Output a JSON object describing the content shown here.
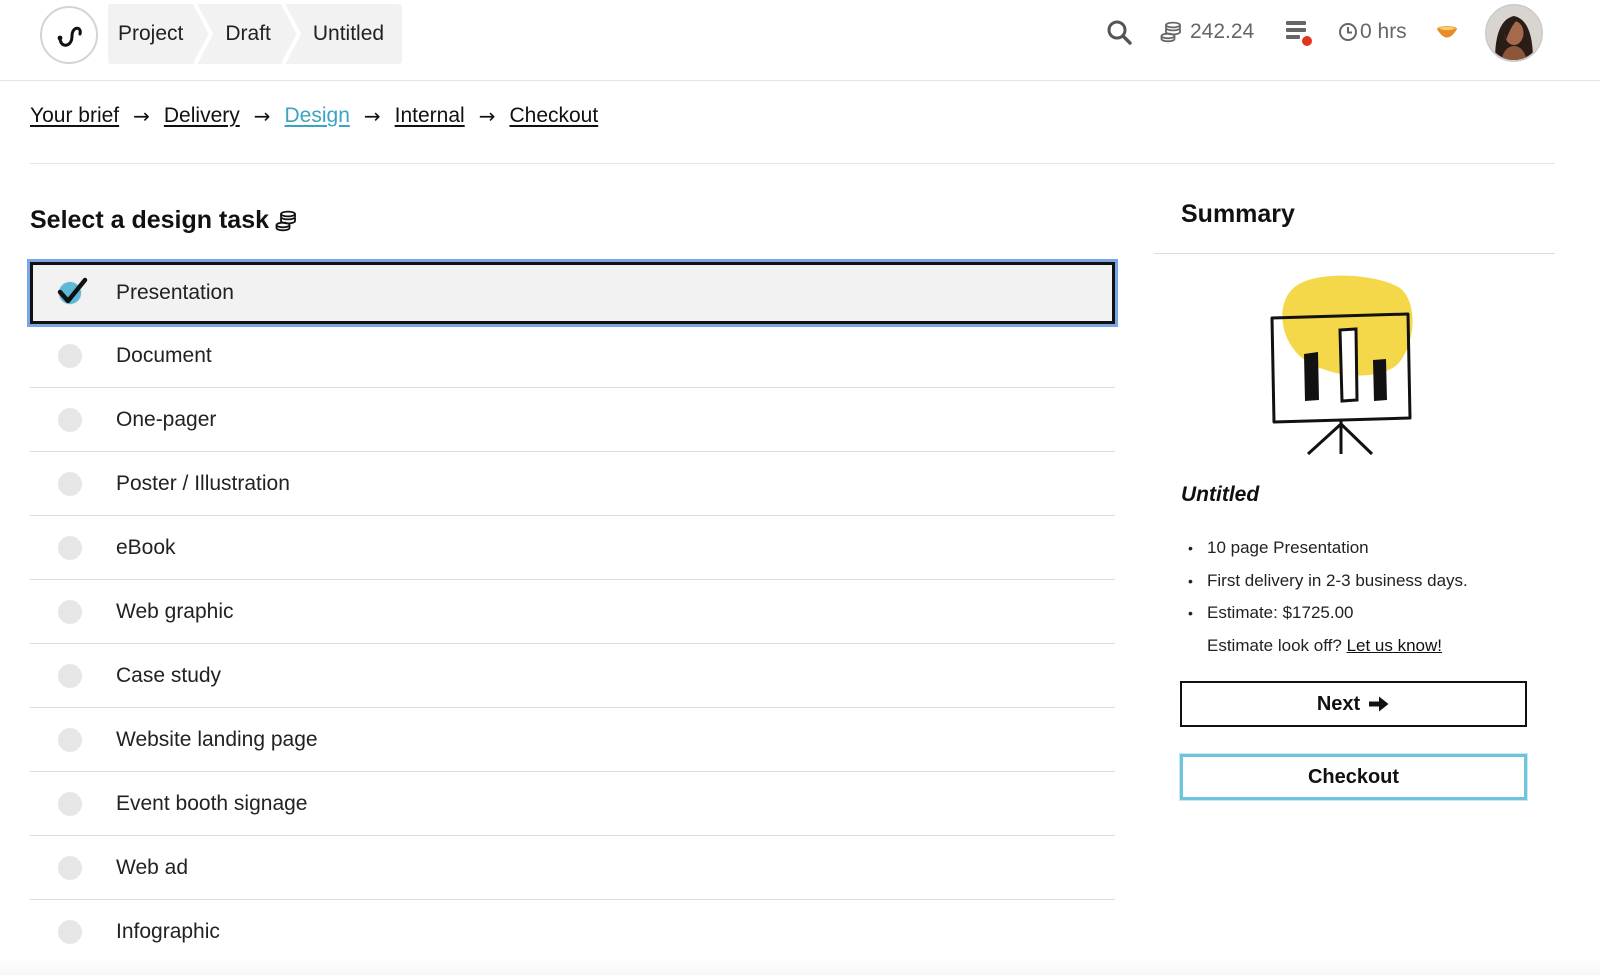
{
  "header": {
    "breadcrumb": [
      "Project",
      "Draft",
      "Untitled"
    ],
    "credits": "242.24",
    "hours": "0 hrs",
    "icons": {
      "logo": "loop-logo-icon",
      "search": "search-icon",
      "credits": "coin-stack-icon",
      "queue": "task-queue-icon",
      "hours": "clock-icon",
      "bowl": "bowl-icon",
      "avatar": "user-avatar"
    },
    "notification_color": "#e0351f"
  },
  "steps": {
    "items": [
      "Your brief",
      "Delivery",
      "Design",
      "Internal",
      "Checkout"
    ],
    "active_index": 2,
    "arrow": "→",
    "active_color": "#3aa4c2"
  },
  "tasks": {
    "title": "Select a design task",
    "selected": "Presentation",
    "items": [
      "Presentation",
      "Document",
      "One-pager",
      "Poster / Illustration",
      "eBook",
      "Web graphic",
      "Case study",
      "Website landing page",
      "Event booth signage",
      "Web ad",
      "Infographic"
    ]
  },
  "summary": {
    "title": "Summary",
    "project_name": "Untitled",
    "bullets": [
      "10 page Presentation",
      "First delivery in 2-3 business days.",
      "Estimate: $1725.00"
    ],
    "estimate_note": "Estimate look off?",
    "estimate_link": "Let us know!",
    "next_label": "Next",
    "checkout_label": "Checkout",
    "illustration_color": "#f5d84a",
    "checkout_border_color": "#6fc4dc"
  }
}
